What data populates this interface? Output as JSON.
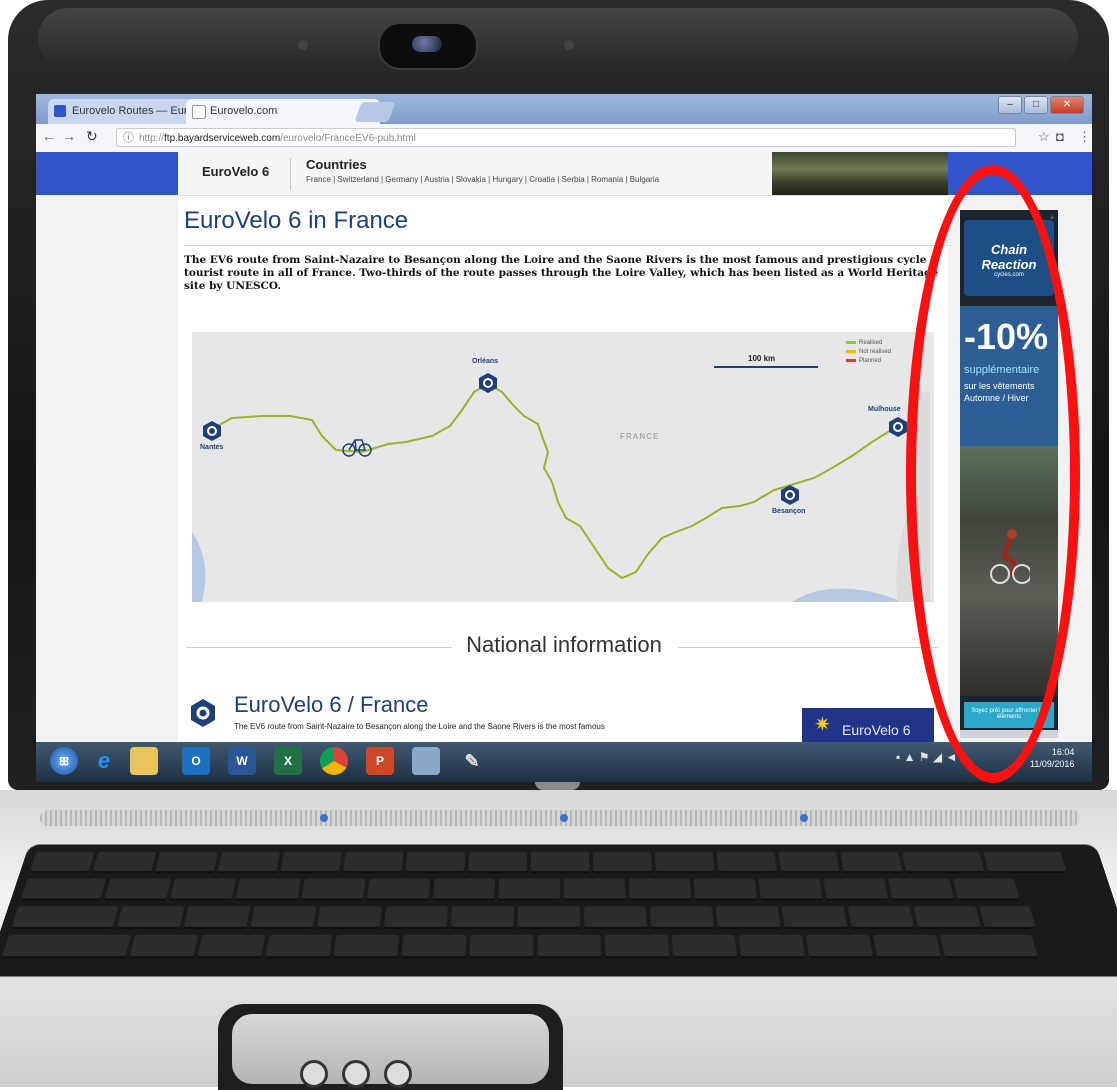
{
  "browser": {
    "tabs": [
      {
        "label": "Eurovelo Routes — Euro",
        "active": false
      },
      {
        "label": "Eurovelo.com",
        "active": true
      }
    ],
    "url": {
      "host": "ftp.bayardserviceweb.com",
      "path": "/eurovelo/FranceEV6-pub.html",
      "scheme": "http://"
    },
    "window_controls": {
      "minimize": "–",
      "maximize": "□",
      "close": "✕"
    }
  },
  "site": {
    "brand": "EuroVelo 6",
    "countries_title": "Countries",
    "countries": "France | Switzerland | Germany | Austria | Slovakia | Hungary | Croatia | Serbia | Romania | Bulgaria",
    "page_title": "EuroVelo 6 in France",
    "intro": "The EV6 route from Saint-Nazaire to Besançon along the Loire and the Saone Rivers is the most famous and prestigious cycle tourist route in all of France. Two-thirds of the route passes through the Loire Valley, which has been listed as a World Heritage site by UNESCO.",
    "map": {
      "cities": [
        "Nantes",
        "Orléans",
        "Mulhouse",
        "Besançon"
      ],
      "country": "FRANCE",
      "scale": "100 km",
      "legend": [
        {
          "label": "Realised",
          "color": "#8cc63f"
        },
        {
          "label": "Not realised",
          "color": "#f2b705"
        },
        {
          "label": "Planned",
          "color": "#e53935"
        }
      ]
    },
    "section_heading": "National information",
    "ev_heading": "EuroVelo 6 / France",
    "ev_text": "The EV6 route from Saint-Nazaire to Besançon along the Loire and the Saone Rivers is the most famous",
    "ev_logo": "EuroVelo 6"
  },
  "ad": {
    "logo": "Chain Reaction",
    "logo_sub": "cycles.com",
    "discount": "-10%",
    "line1": "supplémentaire",
    "line2": "sur les vêtements Automne / Hiver",
    "cta": "Soyez prêt pour affronter les éléments"
  },
  "taskbar": {
    "apps": [
      "start",
      "ie",
      "explorer",
      "outlook",
      "word",
      "excel",
      "chrome",
      "powerpoint",
      "window",
      "paint"
    ],
    "clock_time": "16:04",
    "clock_date": "11/09/2016"
  },
  "colors": {
    "highlight": "#ff1010",
    "site_blue": "#2f55c8",
    "route": "#9ab32c"
  }
}
